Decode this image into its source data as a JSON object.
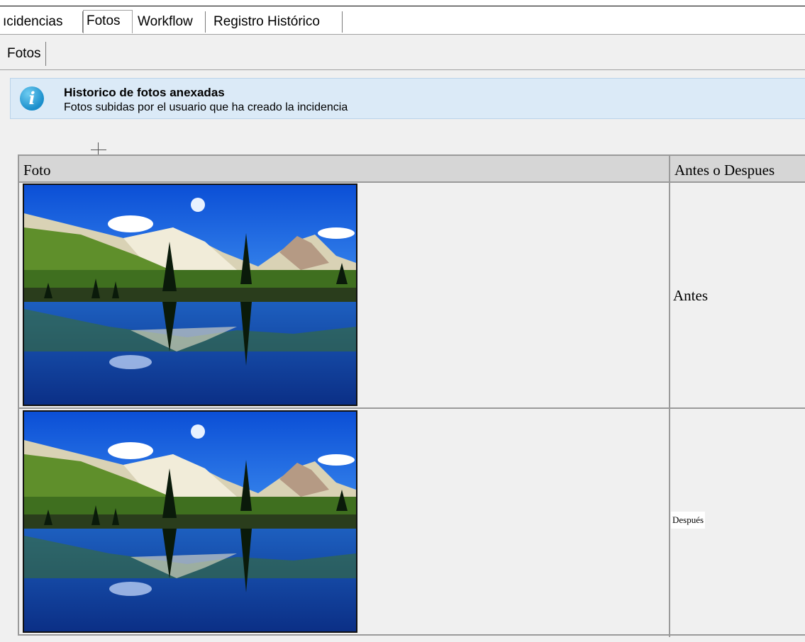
{
  "tabs": [
    {
      "label": "ıcidencias"
    },
    {
      "label": "Fotos",
      "active": true
    },
    {
      "label": "Workflow"
    },
    {
      "label": "Registro Histórico"
    }
  ],
  "subtab": {
    "label": "Fotos"
  },
  "info": {
    "icon": "info-icon",
    "title": "Historico de fotos anexadas",
    "subtitle": "Fotos subidas por el usuario que ha creado la incidencia"
  },
  "grid": {
    "headers": [
      "Foto",
      "Antes o Despues"
    ],
    "rows": [
      {
        "photo": "mountain-lake-photo",
        "when": "Antes"
      },
      {
        "photo": "mountain-lake-photo",
        "when": "Después"
      }
    ]
  },
  "colors": {
    "panel": "#f0f0f0",
    "info_bg": "#dbeaf7",
    "header_bg": "#d6d6d6"
  }
}
